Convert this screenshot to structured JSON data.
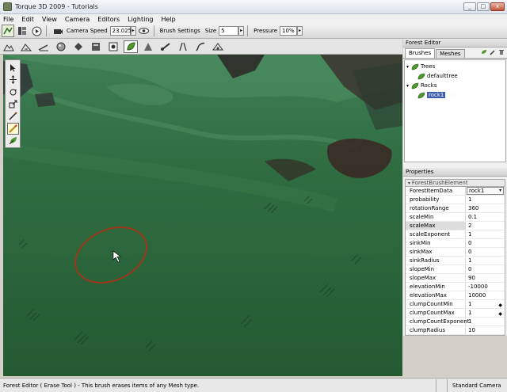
{
  "window": {
    "title": "Torque 3D 2009 - Tutorials",
    "min": "_",
    "max": "□",
    "close": "x"
  },
  "menu": [
    "File",
    "Edit",
    "View",
    "Camera",
    "Editors",
    "Lighting",
    "Help"
  ],
  "toolbar": {
    "camera_speed_label": "Camera Speed",
    "camera_speed_value": "23.025",
    "brush_settings_label": "Brush Settings",
    "size_label": "Size",
    "size_value": "5",
    "pressure_label": "Pressure",
    "pressure_value": "10%"
  },
  "forest_editor": {
    "title": "Forest Editor",
    "tabs": [
      "Brushes",
      "Meshes"
    ],
    "tree": [
      {
        "label": "Trees"
      },
      {
        "label": "defaulttree"
      },
      {
        "label": "Rocks"
      },
      {
        "label": "rock1"
      }
    ]
  },
  "properties": {
    "title": "Properties",
    "section": "ForestBrushElement",
    "rows": [
      {
        "key": "ForestItemData",
        "value": "rock1"
      },
      {
        "key": "probability",
        "value": "1"
      },
      {
        "key": "rotationRange",
        "value": "360"
      },
      {
        "key": "scaleMin",
        "value": "0.1"
      },
      {
        "key": "scaleMax",
        "value": "2"
      },
      {
        "key": "scaleExponent",
        "value": "1"
      },
      {
        "key": "sinkMin",
        "value": "0"
      },
      {
        "key": "sinkMax",
        "value": "0"
      },
      {
        "key": "sinkRadius",
        "value": "1"
      },
      {
        "key": "slopeMin",
        "value": "0"
      },
      {
        "key": "slopeMax",
        "value": "90"
      },
      {
        "key": "elevationMin",
        "value": "-10000"
      },
      {
        "key": "elevationMax",
        "value": "10000"
      },
      {
        "key": "clumpCountMin",
        "value": "1"
      },
      {
        "key": "clumpCountMax",
        "value": "1"
      },
      {
        "key": "clumpCountExponent",
        "value": "1"
      },
      {
        "key": "clumpRadius",
        "value": "10"
      }
    ]
  },
  "status": {
    "message": "Forest Editor ( Erase Tool ) - This brush erases items of any Mesh type.",
    "camera": "Standard Camera"
  },
  "colors": {
    "terrain": "#2b6437",
    "brush_ring": "#a0351e",
    "leaf": "#4f9a2e"
  }
}
